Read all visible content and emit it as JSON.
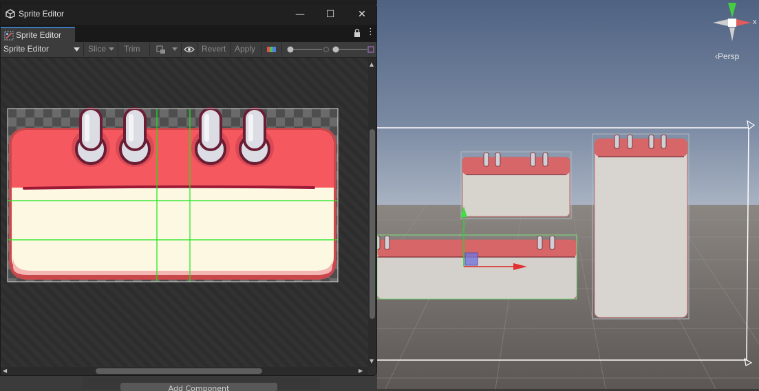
{
  "window": {
    "title": "Sprite Editor",
    "minimize": "—",
    "maximize": "☐",
    "close": "✕",
    "tab_label": "Sprite Editor",
    "more": "⋮"
  },
  "toolbar": {
    "mode": "Sprite Editor",
    "slice": "Slice",
    "trim": "Trim",
    "revert": "Revert",
    "apply": "Apply"
  },
  "scene": {
    "camera_label": "Persp",
    "axis_x": "x"
  },
  "background": {
    "add_component": "Add Component"
  },
  "icons": {
    "window_icon": "unity-logo-icon",
    "tab_icon": "sprite-editor-icon",
    "lock": "lock-icon",
    "dropdown": "chevron-down-icon",
    "visibility": "eye-icon",
    "color_channels": "rgb-channel-icon",
    "zoom": "zoom-slider-icon"
  },
  "colors": {
    "calendar_top": "#f45b63",
    "calendar_body": "#fefbe6",
    "calendar_outline": "#c44747",
    "ring": "#dcdde4",
    "slice_line": "#19e619",
    "tab_accent": "#3a79bb"
  }
}
